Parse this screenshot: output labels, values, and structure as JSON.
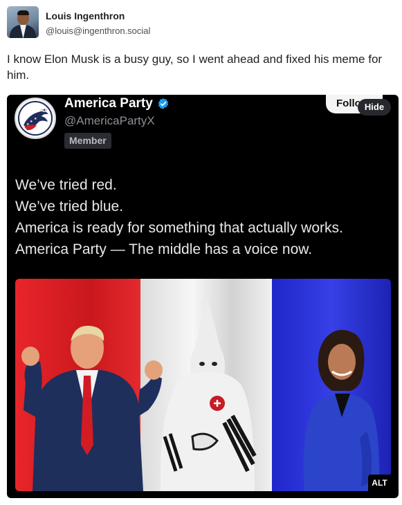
{
  "post": {
    "author_name": "Louis Ingenthron",
    "author_handle": "@louis@ingenthron.social",
    "text": "I know Elon Musk is a busy guy, so I went ahead and fixed his meme for him."
  },
  "embed": {
    "account_name": "America Party",
    "account_handle": "@AmericaPartyX",
    "member_badge": "Member",
    "follow_label": "Follow",
    "hide_label": "Hide",
    "lines": [
      "We’ve tried red.",
      "We’ve tried blue.",
      "America is ready for something that actually works.",
      "America Party — The middle has a voice now."
    ],
    "alt_badge": "ALT",
    "colors": {
      "flag_red": "#e8252a",
      "flag_white": "#f2f2f2",
      "flag_blue": "#2a33d8",
      "verified": "#1d9bf0"
    }
  }
}
